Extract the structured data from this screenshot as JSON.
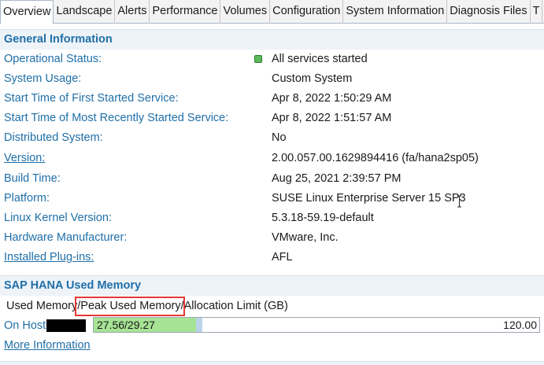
{
  "tabs": [
    {
      "label": "Overview",
      "active": true
    },
    {
      "label": "Landscape"
    },
    {
      "label": "Alerts"
    },
    {
      "label": "Performance"
    },
    {
      "label": "Volumes"
    },
    {
      "label": "Configuration"
    },
    {
      "label": "System Information"
    },
    {
      "label": "Diagnosis Files"
    },
    {
      "label": "T"
    }
  ],
  "general": {
    "title": "General Information",
    "rows": [
      {
        "label": "Operational Status:",
        "value": "All services started",
        "status_color": "#5cb85c"
      },
      {
        "label": "System Usage:",
        "value": "Custom System"
      },
      {
        "label": "Start Time of First Started Service:",
        "value": "Apr 8, 2022 1:50:29 AM"
      },
      {
        "label": "Start Time of Most Recently Started Service:",
        "value": "Apr 8, 2022 1:51:57 AM"
      },
      {
        "label": "Distributed System:",
        "value": "No"
      },
      {
        "label": "Version:",
        "value": "2.00.057.00.1629894416 (fa/hana2sp05)",
        "link": true
      },
      {
        "label": "Build Time:",
        "value": "Aug 25, 2021 2:39:57 PM"
      },
      {
        "label": "Platform:",
        "value": "SUSE Linux Enterprise Server 15 SP3"
      },
      {
        "label": "Linux Kernel Version:",
        "value": "5.3.18-59.19-default"
      },
      {
        "label": "Hardware Manufacturer:",
        "value": "VMware, Inc."
      },
      {
        "label": "Installed Plug-ins:",
        "value": "AFL",
        "link": true
      }
    ]
  },
  "memory": {
    "title": "SAP HANA Used Memory",
    "caption_used": "Used Memory",
    "caption_peak": "/Peak Used Memory",
    "caption_limit": "/Allocation Limit (GB)",
    "host_label": "On Host",
    "used_peak_text": "27.56/29.27",
    "limit_text": "120.00",
    "used_value": 27.56,
    "peak_value": 29.27,
    "limit_value": 120.0,
    "more_info": "More Information"
  },
  "colors": {
    "accent": "#1f6fa8",
    "highlight": "#e53935",
    "used_fill": "#a6e394",
    "peak_fill": "#bcd4ea"
  }
}
